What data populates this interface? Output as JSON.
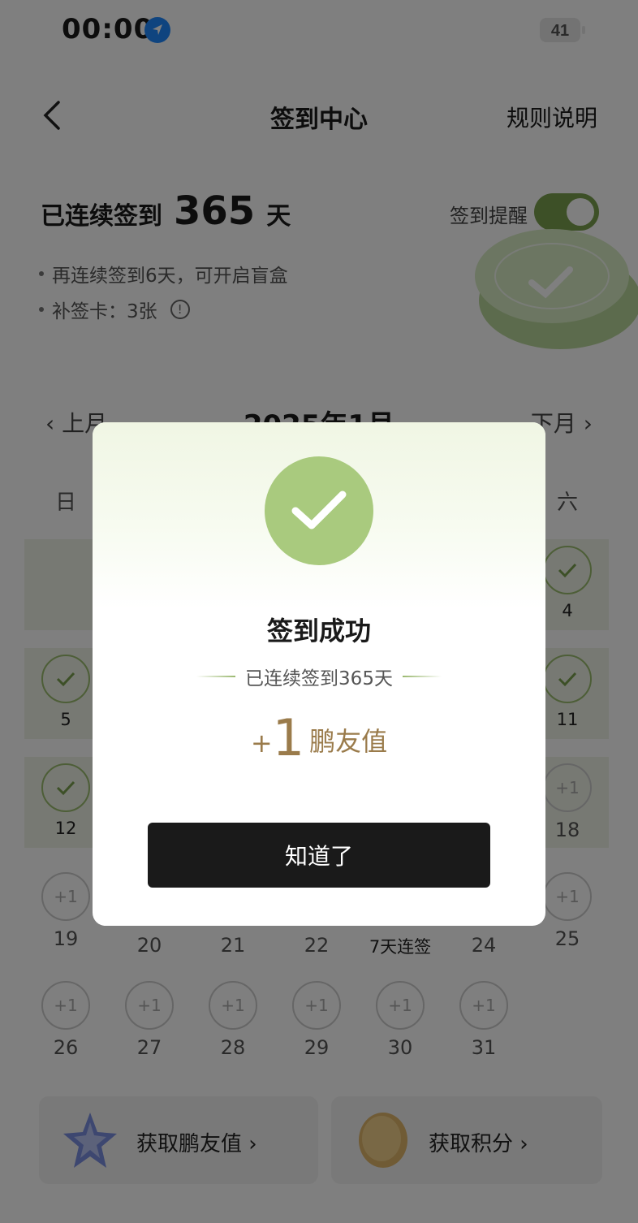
{
  "status_bar": {
    "time": "00:00",
    "battery": "41"
  },
  "header": {
    "title": "签到中心",
    "rules": "规则说明"
  },
  "streak": {
    "prefix": "已连续签到",
    "days": "365",
    "suffix": "天",
    "reminder_label": "签到提醒",
    "reminder_on": true
  },
  "bullets": [
    "再连续签到6天，可开启盲盒",
    "补签卡：3张"
  ],
  "calendar": {
    "prev": "上月",
    "month": "2025年1月",
    "next": "下月",
    "weekdays": [
      "日",
      "六"
    ],
    "rows": [
      {
        "cells": [
          {
            "day": "4",
            "status": "done"
          }
        ]
      },
      {
        "cells": [
          {
            "day": "5",
            "status": "done"
          },
          {
            "day": "11",
            "status": "done"
          }
        ]
      },
      {
        "cells": [
          {
            "day": "12",
            "status": "done"
          },
          {
            "day": "18",
            "status": "+1"
          }
        ]
      },
      {
        "cells": [
          {
            "day": "19",
            "status": "+1"
          },
          {
            "day": "20"
          },
          {
            "day": "21"
          },
          {
            "day": "22"
          },
          {
            "day": "7天连签"
          },
          {
            "day": "24"
          },
          {
            "day": "25",
            "status": "+1"
          }
        ]
      },
      {
        "cells": [
          {
            "day": "26",
            "status": "+1"
          },
          {
            "day": "27",
            "status": "+1"
          },
          {
            "day": "28",
            "status": "+1"
          },
          {
            "day": "29",
            "status": "+1"
          },
          {
            "day": "30",
            "status": "+1"
          },
          {
            "day": "31",
            "status": "+1"
          }
        ]
      }
    ]
  },
  "cards": [
    {
      "label": "获取鹏友值 ›"
    },
    {
      "label": "获取积分 ›"
    }
  ],
  "modal": {
    "title": "签到成功",
    "subtitle": "已连续签到365天",
    "reward_plus": "+",
    "reward_value": "1",
    "reward_unit": "鹏友值",
    "button": "知道了"
  },
  "colors": {
    "accent_green": "#a9ca7e",
    "reward_gold": "#9a7b4b",
    "button_dark": "#1a1a1a"
  }
}
